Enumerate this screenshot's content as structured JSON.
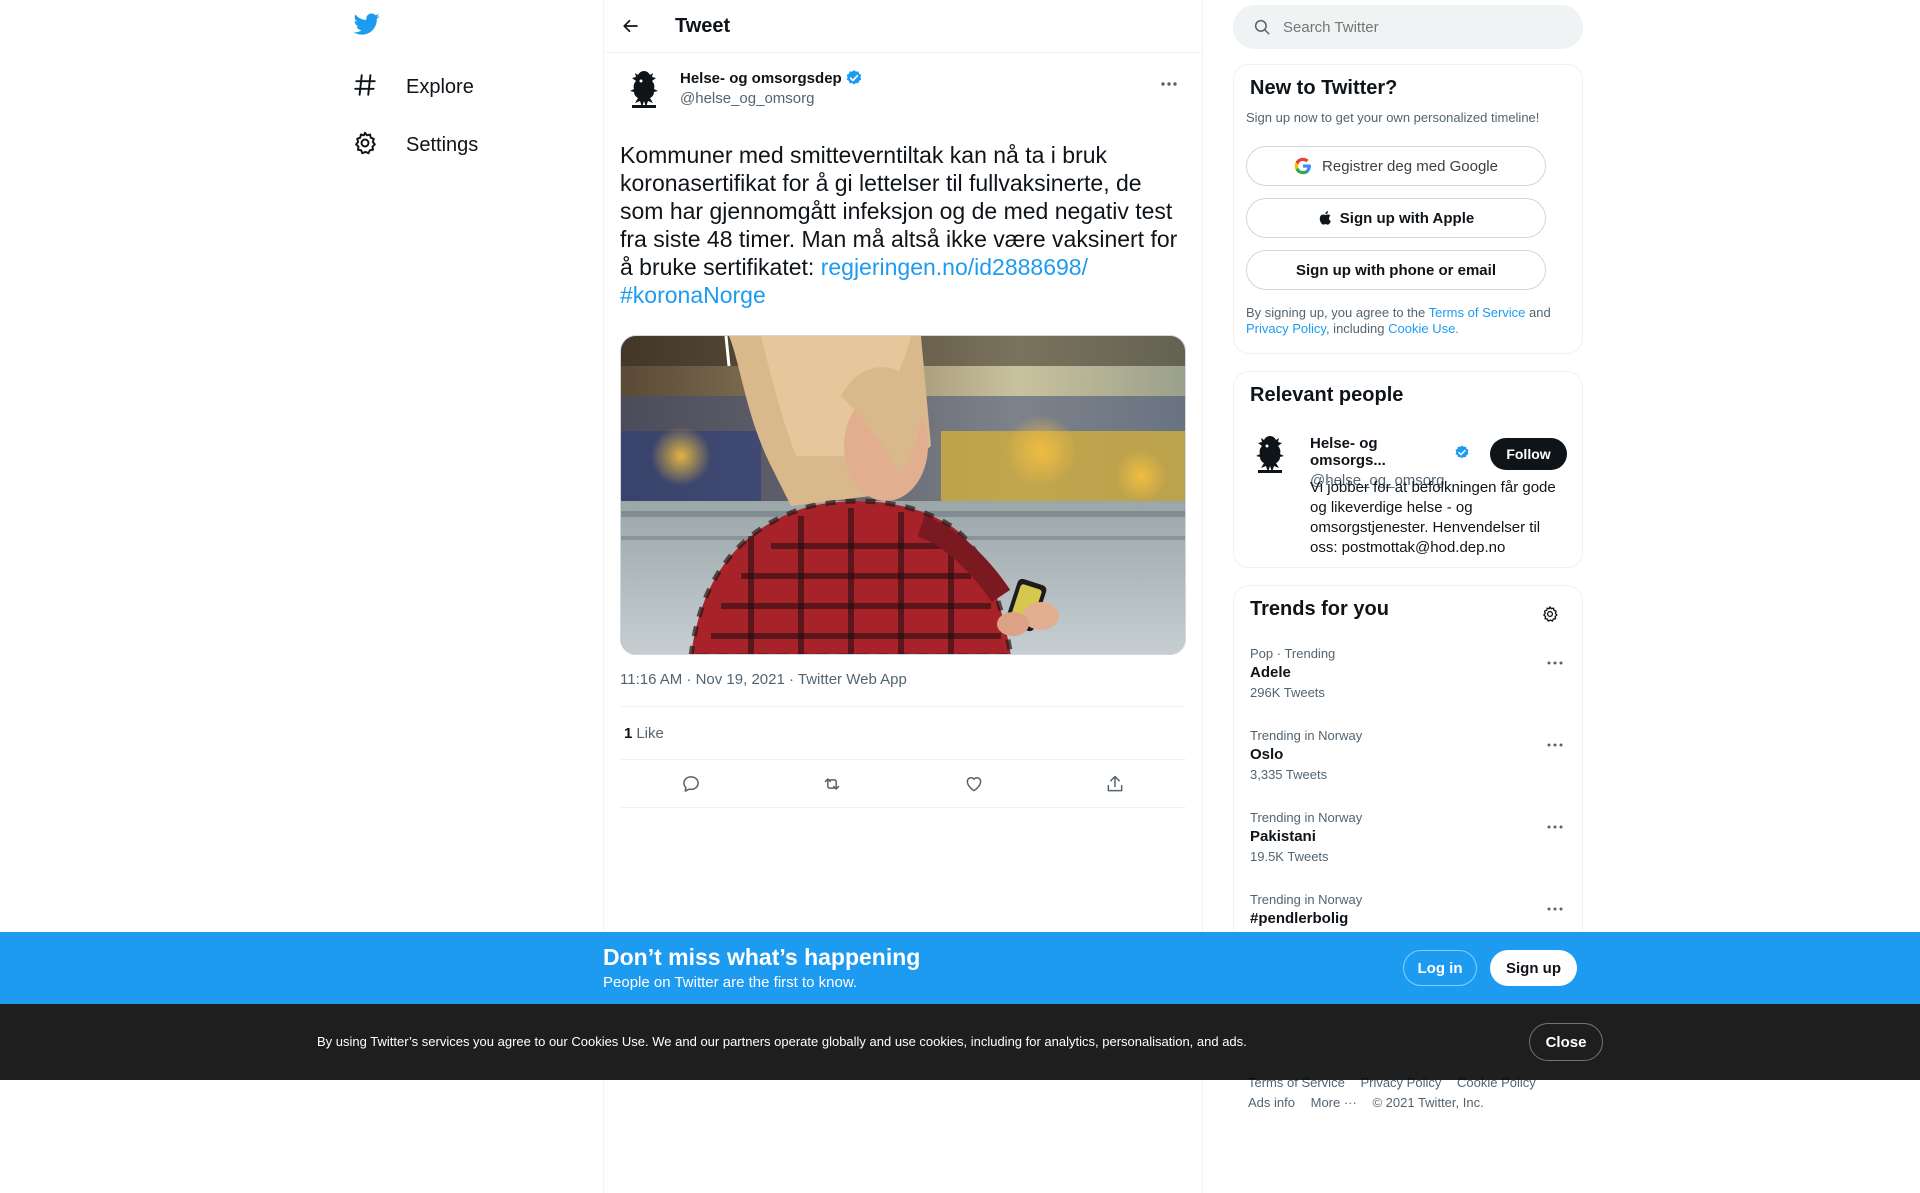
{
  "nav": {
    "items": [
      {
        "label": "Explore",
        "icon": "hashtag-icon"
      },
      {
        "label": "Settings",
        "icon": "gear-icon"
      }
    ]
  },
  "header": {
    "title": "Tweet"
  },
  "tweet": {
    "author_name": "Helse- og omsorgsdep",
    "author_handle": "@helse_og_omsorg",
    "text": "Kommuner med smitteverntiltak kan nå ta i bruk koronasertifikat for å gi lettelser til fullvaksinerte, de som har gjennomgått infeksjon og de med negativ test fra siste 48 timer. Man må altså ikke være vaksinert for å bruke sertifikatet: ",
    "link": "regjeringen.no/id2888698/",
    "hashtag": "#koronaNorge",
    "timestamp": "11:16 AM · Nov 19, 2021 · Twitter Web App",
    "like_count": "1",
    "like_label": "Like"
  },
  "search": {
    "placeholder": "Search Twitter"
  },
  "new_to_twitter": {
    "title": "New to Twitter?",
    "subtitle": "Sign up now to get your own personalized timeline!",
    "google_button": "Registrer deg med Google",
    "apple_button": "Sign up with Apple",
    "phone_button": "Sign up with phone or email",
    "terms_prefix": "By signing up, you agree to the ",
    "terms_link": "Terms of Service",
    "terms_and": " and ",
    "privacy_link": "Privacy Policy",
    "terms_including": ", including ",
    "cookie_link": "Cookie Use."
  },
  "relevant": {
    "title": "Relevant people",
    "name": "Helse- og omsorgs...",
    "handle": "@helse_og_omsorg",
    "follow_label": "Follow",
    "bio": "Vi jobber for at befolkningen får gode og likeverdige helse - og omsorgstjenester. Henvendelser til oss: postmottak@hod.dep.no"
  },
  "trends": {
    "title": "Trends for you",
    "items": [
      {
        "context": "Pop · Trending",
        "name": "Adele",
        "count": "296K Tweets"
      },
      {
        "context": "Trending in Norway",
        "name": "Oslo",
        "count": "3,335 Tweets"
      },
      {
        "context": "Trending in Norway",
        "name": "Pakistani",
        "count": "19.5K Tweets"
      },
      {
        "context": "Trending in Norway",
        "name": "#pendlerbolig",
        "count": ""
      }
    ]
  },
  "footer": {
    "links_row1": [
      "Terms of Service",
      "Privacy Policy",
      "Cookie Policy"
    ],
    "links_row2": [
      "Ads info",
      "More ···",
      "© 2021 Twitter, Inc."
    ]
  },
  "signup_bar": {
    "title": "Don’t miss what’s happening",
    "subtitle": "People on Twitter are the first to know.",
    "login_label": "Log in",
    "signup_label": "Sign up"
  },
  "cookie_bar": {
    "text": "By using Twitter’s services you agree to our Cookies Use. We and our partners operate globally and use cookies, including for analytics, personalisation, and ads.",
    "close_label": "Close"
  },
  "colors": {
    "accent": "#1d9bf0",
    "text": "#0f1419",
    "secondary": "#536471"
  }
}
